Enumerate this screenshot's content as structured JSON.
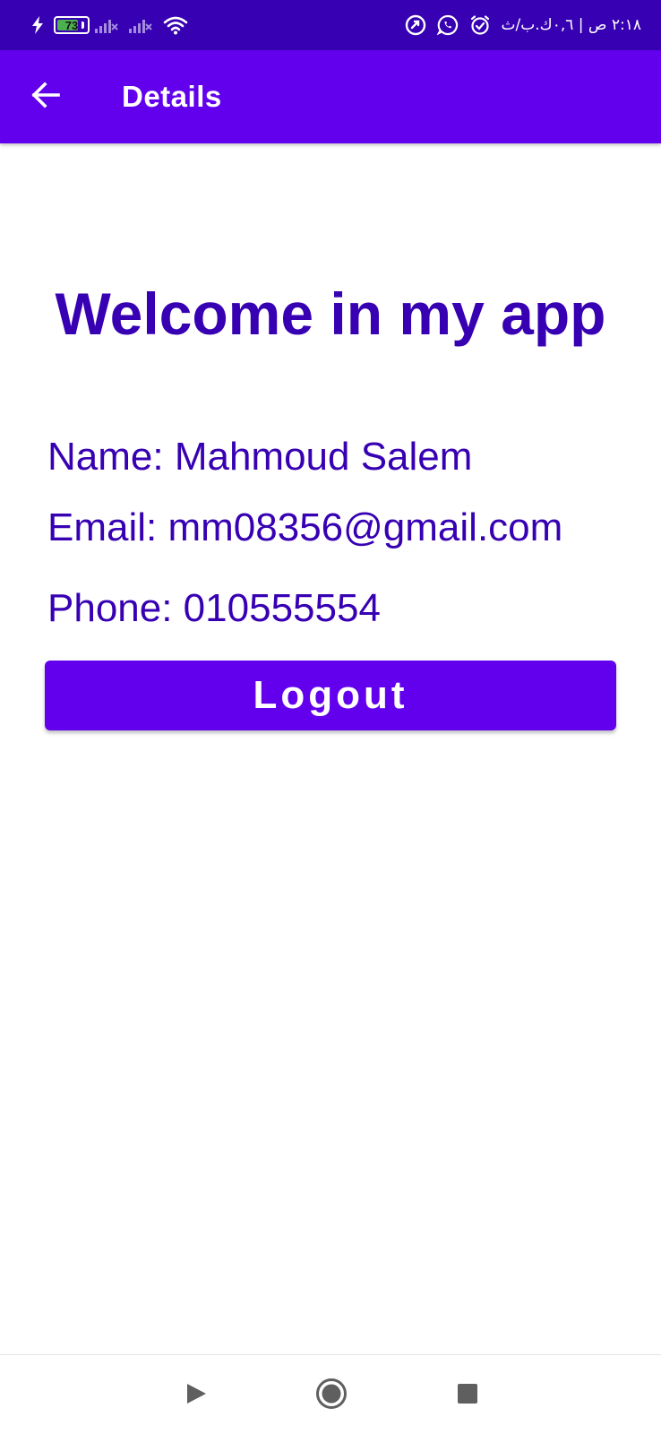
{
  "status_bar": {
    "battery_level": 73,
    "battery_label": "73",
    "time_text": "٢:١٨ ص | ٠,٦ك.ب/ث",
    "colors": {
      "background": "#3700b3",
      "battery_fill": "#4caf50"
    },
    "icons": [
      "charging-icon",
      "battery-icon",
      "signal-icon",
      "signal-icon",
      "wifi-icon",
      "sync-icon",
      "whatsapp-icon",
      "alarm-icon"
    ]
  },
  "app_bar": {
    "title": "Details",
    "back_icon": "arrow-left-icon",
    "color": "#6200ee"
  },
  "main": {
    "welcome_text": "Welcome in my app",
    "name_line": "Name: Mahmoud Salem",
    "email_line": "Email: mm08356@gmail.com",
    "phone_line": "Phone: 010555554",
    "logout_label": "Logout",
    "text_color": "#3700b3",
    "button_color": "#6200ee"
  },
  "nav_bar": {
    "icons": [
      "play-triangle-icon",
      "home-circle-icon",
      "recents-square-icon"
    ]
  }
}
